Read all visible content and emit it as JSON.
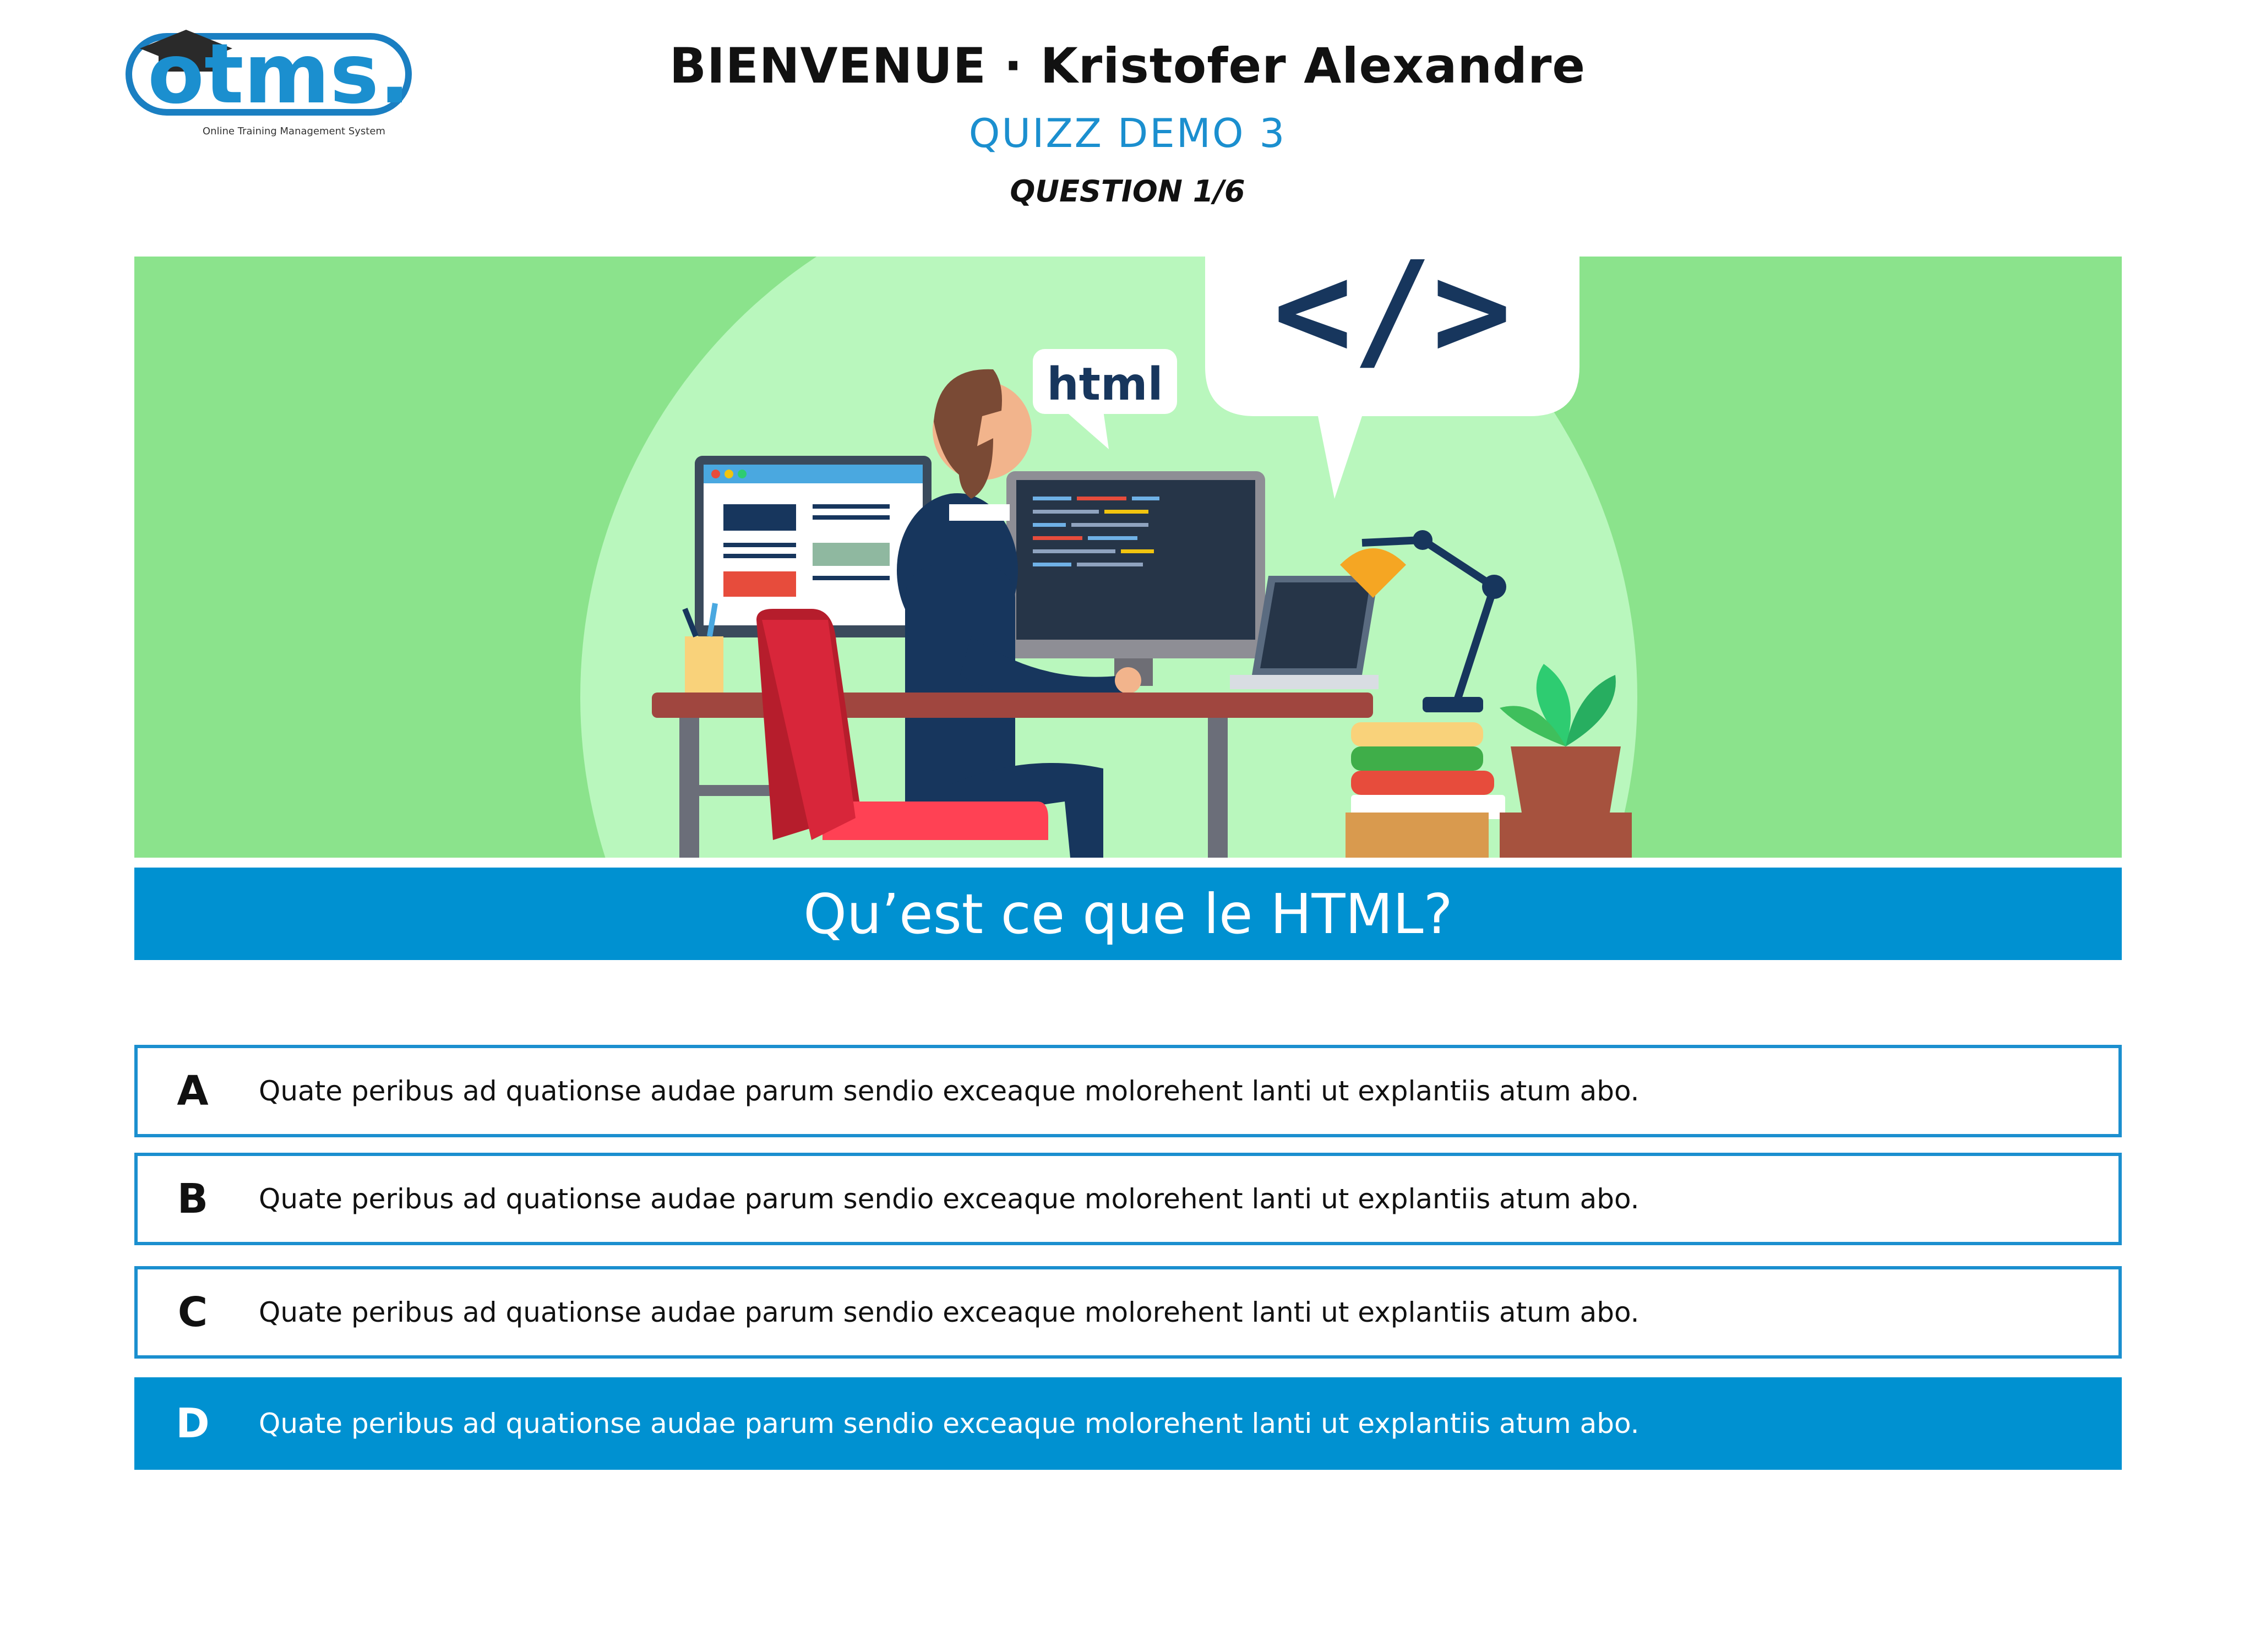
{
  "header": {
    "logo_text": "otms.",
    "logo_subtitle": "Online Training Management System",
    "welcome": "BIENVENUE · Kristofer Alexandre",
    "quiz_title": "QUIZZ DEMO 3",
    "question_counter": "QUESTION 1/6"
  },
  "banner": {
    "bubble_small": "html",
    "bubble_large": "</>"
  },
  "question": {
    "text": "Qu’est ce que le HTML?"
  },
  "answers": [
    {
      "letter": "A",
      "text": "Quate peribus ad quationse audae parum sendio exceaque molorehent lanti ut explantiis atum abo.",
      "selected": false
    },
    {
      "letter": "B",
      "text": "Quate peribus ad quationse audae parum sendio exceaque molorehent lanti ut explantiis atum abo.",
      "selected": false
    },
    {
      "letter": "C",
      "text": "Quate peribus ad quationse audae parum sendio exceaque molorehent lanti ut explantiis atum abo.",
      "selected": false
    },
    {
      "letter": "D",
      "text": "Quate peribus ad quationse audae parum sendio exceaque molorehent lanti ut explantiis atum abo.",
      "selected": true
    }
  ],
  "colors": {
    "accent": "#0091d1",
    "banner_bg": "#8be38c",
    "banner_circle": "#b9f7bd",
    "title_blue": "#1b8fcf"
  }
}
